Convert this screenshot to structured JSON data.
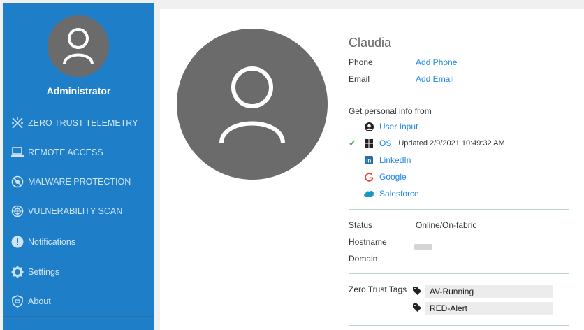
{
  "sidebar": {
    "admin_name": "Administrator",
    "nav_items": [
      {
        "label": "ZERO TRUST TELEMETRY",
        "icon": "telemetry-icon"
      },
      {
        "label": "REMOTE ACCESS",
        "icon": "remote-access-icon"
      },
      {
        "label": "MALWARE PROTECTION",
        "icon": "malware-protection-icon"
      },
      {
        "label": "VULNERABILITY SCAN",
        "icon": "vulnerability-scan-icon"
      }
    ],
    "secondary_items": [
      {
        "label": "Notifications",
        "icon": "notification-icon"
      },
      {
        "label": "Settings",
        "icon": "gear-icon"
      },
      {
        "label": "About",
        "icon": "about-icon"
      }
    ]
  },
  "user": {
    "name": "Claudia",
    "phone_label": "Phone",
    "phone_action": "Add Phone",
    "email_label": "Email",
    "email_action": "Add Email"
  },
  "sources": {
    "heading": "Get personal info from",
    "items": [
      {
        "label": "User Input",
        "icon": "user-input-icon",
        "checked": false,
        "updated": ""
      },
      {
        "label": "OS",
        "icon": "windows-icon",
        "checked": true,
        "updated": "Updated 2/9/2021 10:49:32 AM"
      },
      {
        "label": "LinkedIn",
        "icon": "linkedin-icon",
        "checked": false,
        "updated": ""
      },
      {
        "label": "Google",
        "icon": "google-icon",
        "checked": false,
        "updated": ""
      },
      {
        "label": "Salesforce",
        "icon": "salesforce-icon",
        "checked": false,
        "updated": ""
      }
    ]
  },
  "status": {
    "status_label": "Status",
    "status_value": "Online/On-fabric",
    "hostname_label": "Hostname",
    "domain_label": "Domain"
  },
  "tags": {
    "label": "Zero Trust Tags",
    "items": [
      "AV-Running",
      "RED-Alert"
    ]
  },
  "colors": {
    "sidebar_bg": "#1e7fc8",
    "link": "#1e88e5",
    "check": "#4caf50",
    "avatar_bg": "#6b6b6b"
  }
}
